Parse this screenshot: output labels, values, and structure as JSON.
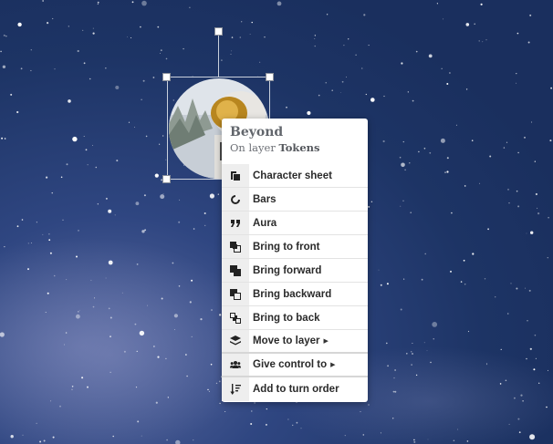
{
  "token": {
    "name": "Beyond",
    "layer_prefix": "On layer",
    "layer_name": "Tokens"
  },
  "menu": {
    "items": [
      {
        "label": "Character sheet",
        "icon": "character-sheet-icon"
      },
      {
        "label": "Bars",
        "icon": "bars-icon"
      },
      {
        "label": "Aura",
        "icon": "aura-icon"
      },
      {
        "label": "Bring to front",
        "icon": "bring-to-front-icon"
      },
      {
        "label": "Bring forward",
        "icon": "bring-forward-icon"
      },
      {
        "label": "Bring backward",
        "icon": "bring-backward-icon"
      },
      {
        "label": "Bring to back",
        "icon": "bring-to-back-icon"
      },
      {
        "label": "Move to layer",
        "icon": "layers-icon",
        "submenu": true
      },
      {
        "label": "Give control to",
        "icon": "users-icon",
        "submenu": true
      },
      {
        "label": "Add to turn order",
        "icon": "sort-icon"
      }
    ]
  },
  "colors": {
    "background": "#1f3566",
    "menu_icon_column": "#eeeeee",
    "selection_handle": "#ffffff"
  }
}
